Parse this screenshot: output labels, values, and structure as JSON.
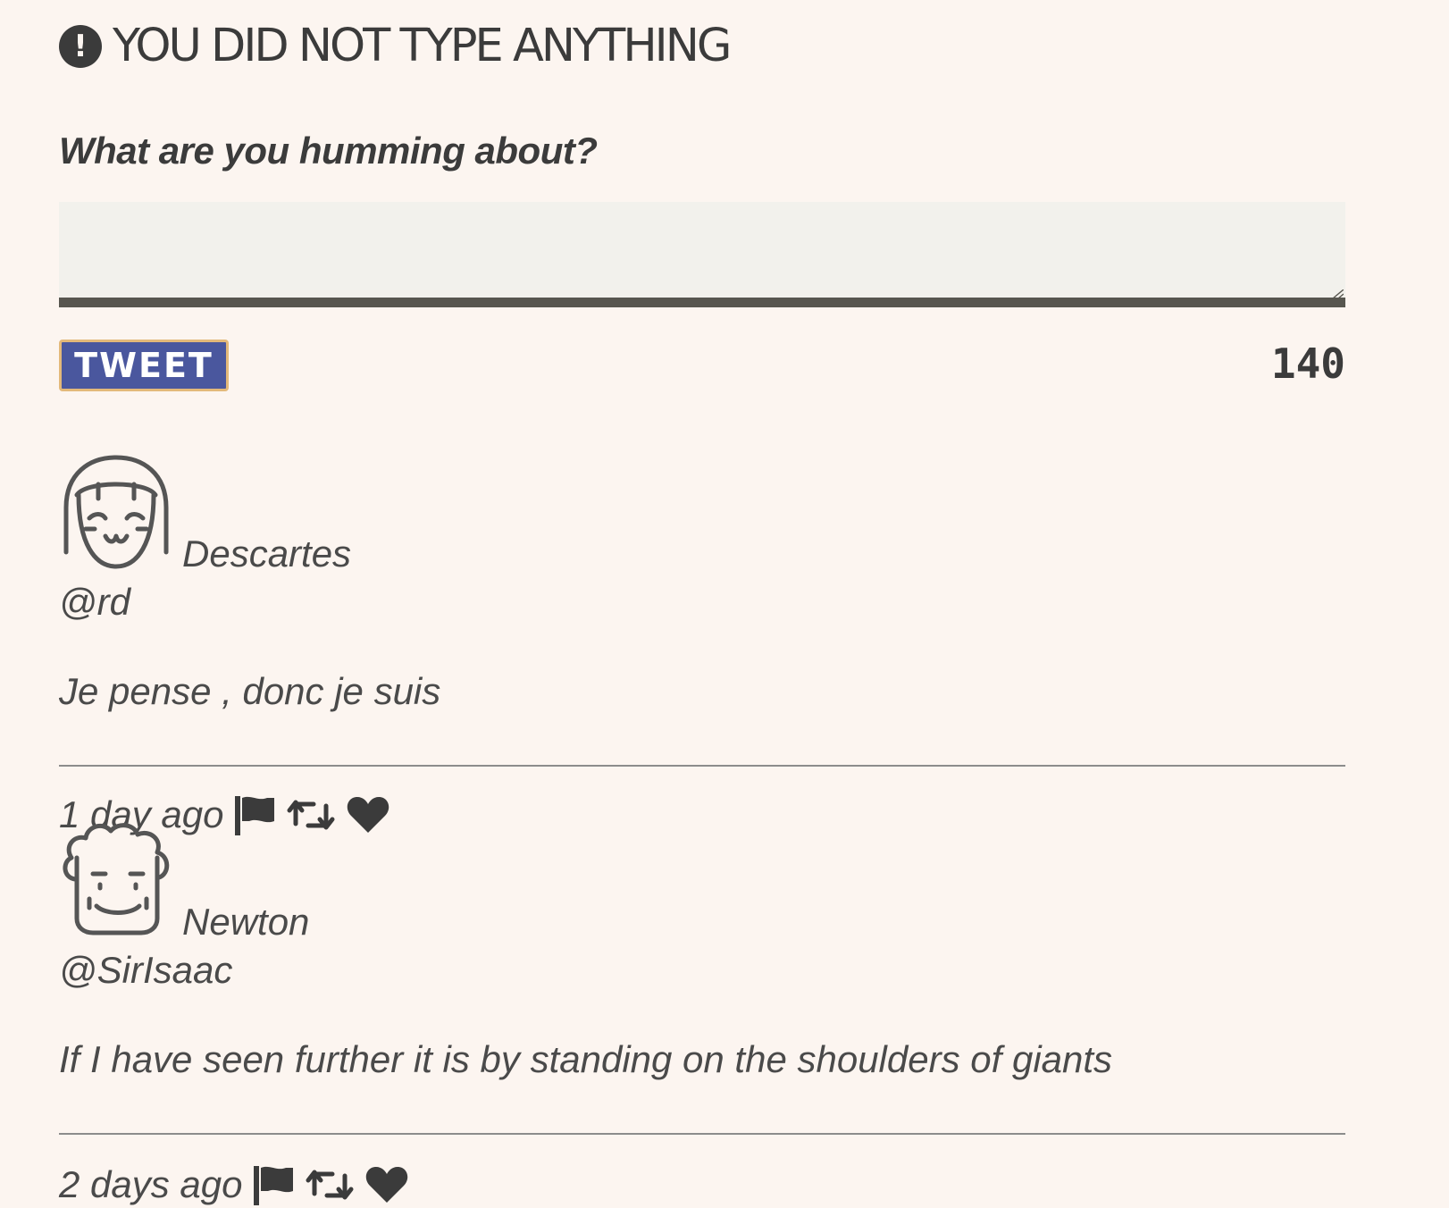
{
  "error": {
    "icon": "exclamation-circle-icon",
    "message": "YOU DID NOT TYPE ANYTHING"
  },
  "compose": {
    "label": "What are you humming about?",
    "value": "",
    "button_label": "TWEET",
    "char_count": "140"
  },
  "colors": {
    "background": "#fcf5f0",
    "text": "#3b3b3b",
    "button": "#4a579e",
    "button_border": "#e3b97a",
    "input_bg": "#f2f1ec",
    "input_border": "#57564f"
  },
  "tweets": [
    {
      "name": "Descartes",
      "handle": "@rd",
      "text": "Je pense , donc je suis",
      "time": "1 day ago",
      "avatar": "girl-avatar-icon",
      "actions": [
        "flag-icon",
        "retweet-icon",
        "heart-icon"
      ]
    },
    {
      "name": "Newton",
      "handle": "@SirIsaac",
      "text": "If I have seen further it is by standing on the shoulders of giants",
      "time": "2 days ago",
      "avatar": "curly-hair-avatar-icon",
      "actions": [
        "flag-icon",
        "retweet-icon",
        "heart-icon"
      ]
    }
  ]
}
